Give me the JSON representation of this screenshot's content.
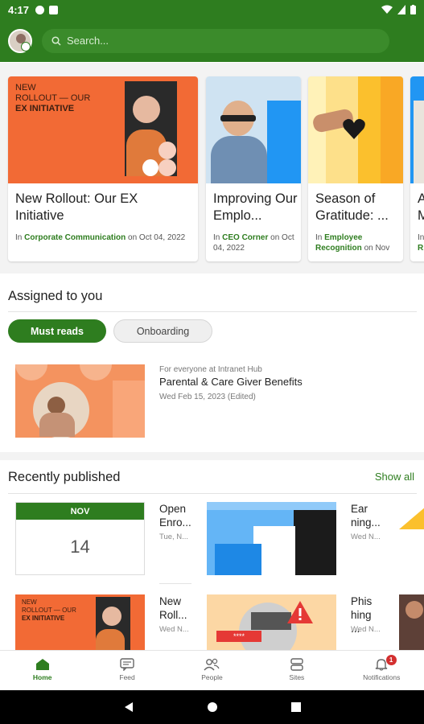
{
  "status_bar": {
    "time": "4:17"
  },
  "app_bar": {
    "search_placeholder": "Search..."
  },
  "hero_cards": [
    {
      "title": "New Rollout: Our EX Initiative",
      "category": "Corporate Communication",
      "in_label": "In",
      "date": "on Oct 04, 2022",
      "image_text": [
        "NEW",
        "ROLLOUT — OUR",
        "EX INITIATIVE"
      ]
    },
    {
      "title": "Improving Our Emplo...",
      "category": "CEO Corner",
      "in_label": "In",
      "date": "on Oct 04, 2022"
    },
    {
      "title": "Season of Gratitude: ...",
      "category": "Employee Recognition",
      "in_label": "In",
      "date": "on Nov"
    },
    {
      "title": "A... M...",
      "category": "R...",
      "in_label": "In",
      "date": ""
    }
  ],
  "assigned": {
    "title": "Assigned to you",
    "chips": [
      "Must reads",
      "Onboarding"
    ],
    "item": {
      "audience": "For everyone at Intranet Hub",
      "title": "Parental & Care Giver Benefits",
      "date": "Wed Feb 15, 2023 (Edited)"
    }
  },
  "recent": {
    "title": "Recently published",
    "show_all": "Show all",
    "calendar": {
      "month": "NOV",
      "day": "14"
    },
    "tiles": [
      {
        "text": "Open Enro...",
        "date": "Tue, N..."
      },
      {
        "text": "Ear ning...",
        "date": "Wed N..."
      },
      {
        "text": "New Roll...",
        "date": "Wed N..."
      },
      {
        "text": "Phis hing ...",
        "date": "Wed N..."
      }
    ],
    "rollout_image_text": [
      "NEW",
      "ROLLOUT — OUR",
      "EX INITIATIVE"
    ],
    "password_mask": "****"
  },
  "bottom_nav": [
    {
      "label": "Home",
      "icon": "home-icon"
    },
    {
      "label": "Feed",
      "icon": "feed-icon"
    },
    {
      "label": "People",
      "icon": "people-icon"
    },
    {
      "label": "Sites",
      "icon": "sites-icon"
    },
    {
      "label": "Notifications",
      "icon": "bell-icon",
      "badge": "1"
    }
  ],
  "colors": {
    "brand": "#2e7d1f",
    "accent_orange": "#f26a35",
    "badge": "#d32f2f"
  }
}
